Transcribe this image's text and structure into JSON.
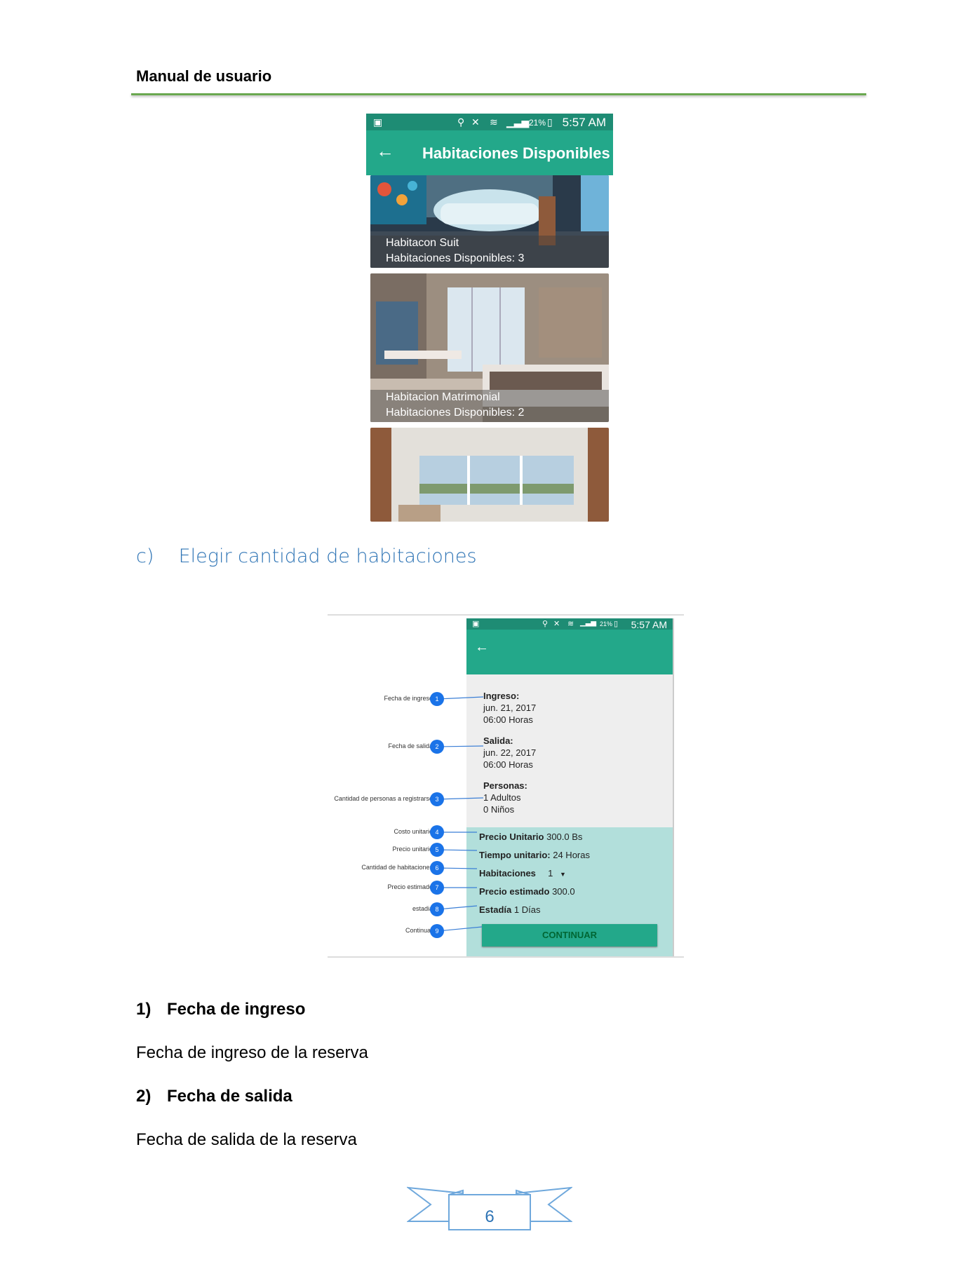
{
  "header": {
    "title": "Manual de usuario"
  },
  "phone1": {
    "status_pct": "21%",
    "status_time": "5:57 AM",
    "title": "Habitaciones Disponibles",
    "cards": [
      {
        "name": "Habitacon Suit",
        "available": "Habitaciones Disponibles: 3"
      },
      {
        "name": "Habitacion Matrimonial",
        "available": "Habitaciones Disponibles: 2"
      },
      {
        "name": "",
        "available": ""
      }
    ]
  },
  "section": {
    "marker": "c)",
    "title": "Elegir cantidad de habitaciones"
  },
  "phone2": {
    "status_pct": "21%",
    "status_time": "5:57 AM",
    "ingreso_label": "Ingreso:",
    "ingreso_date": "jun. 21, 2017",
    "ingreso_time": "06:00 Horas",
    "salida_label": "Salida:",
    "salida_date": "jun. 22, 2017",
    "salida_time": "06:00 Horas",
    "personas_label": "Personas:",
    "adultos": "1 Adultos",
    "ninos": "0 Niños",
    "precio_unitario_label": "Precio Unitario",
    "precio_unitario_value": "300.0 Bs",
    "tiempo_unitario_label": "Tiempo unitario:",
    "tiempo_unitario_value": "24 Horas",
    "habitaciones_label": "Habitaciones",
    "habitaciones_value": "1",
    "precio_estimado_label": "Precio estimado",
    "precio_estimado_value": "300.0",
    "estadia_label": "Estadía",
    "estadia_value": "1 Días",
    "continue_label": "CONTINUAR"
  },
  "callouts": [
    {
      "n": "1",
      "label": "Fecha de ingreso"
    },
    {
      "n": "2",
      "label": "Fecha de salida"
    },
    {
      "n": "3",
      "label": "Cantidad de personas a registrarse"
    },
    {
      "n": "4",
      "label": "Costo unitario"
    },
    {
      "n": "5",
      "label": "Precio unitario"
    },
    {
      "n": "6",
      "label": "Cantidad de habitaciones"
    },
    {
      "n": "7",
      "label": "Precio estimado"
    },
    {
      "n": "8",
      "label": "estadia"
    },
    {
      "n": "9",
      "label": "Continuar"
    }
  ],
  "items": [
    {
      "num": "1)",
      "title": "Fecha de ingreso",
      "desc": "Fecha de ingreso de la reserva"
    },
    {
      "num": "2)",
      "title": "Fecha de salida",
      "desc": "Fecha de salida de la reserva"
    }
  ],
  "footer": {
    "page": "6"
  },
  "colors": {
    "rule": "#6aa84f",
    "teal": "#23a88a",
    "heading": "#2e74b5",
    "badge": "#1a73e8"
  }
}
